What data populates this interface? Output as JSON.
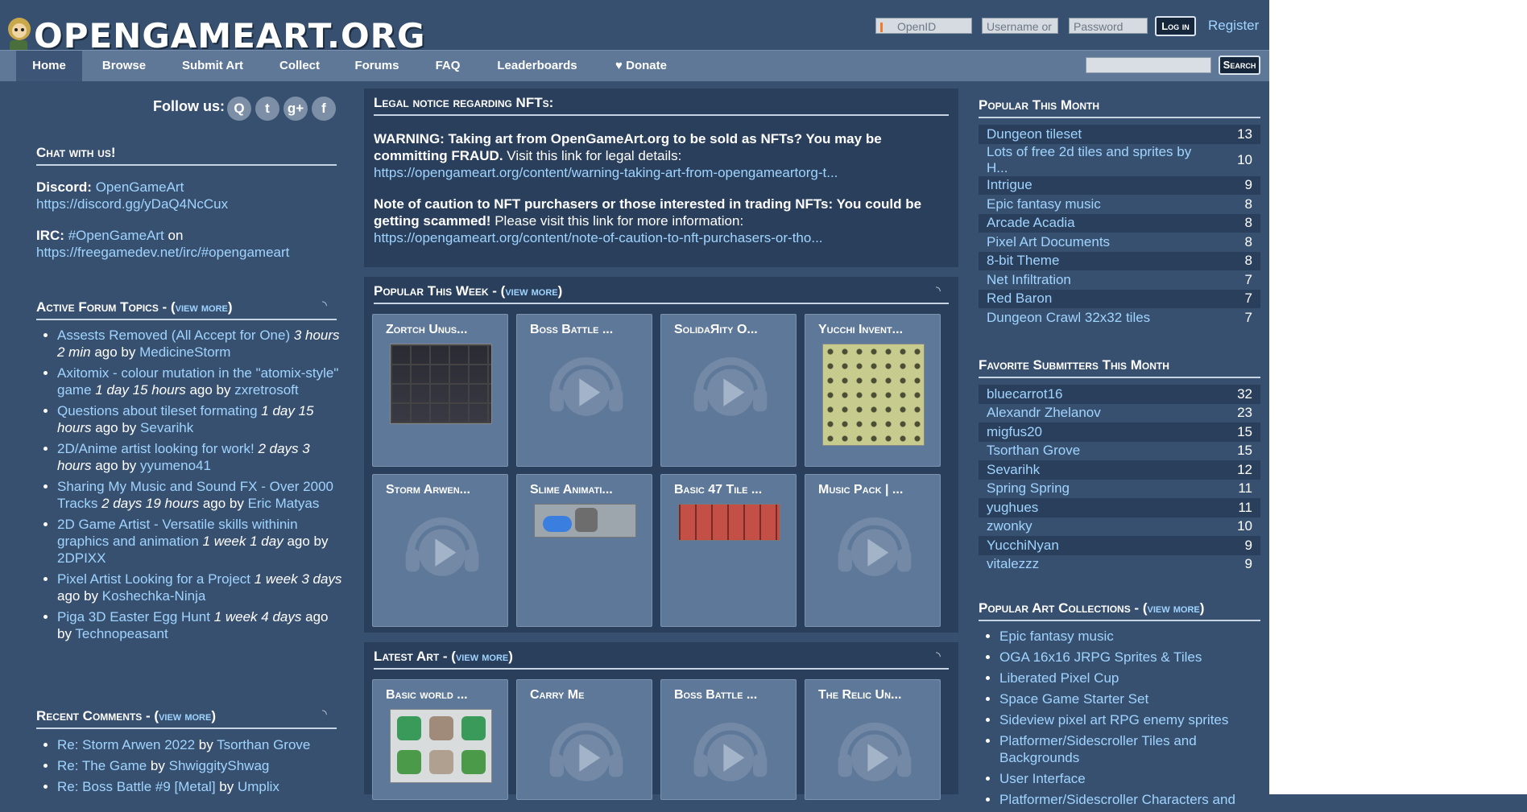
{
  "header": {
    "site_name": "OpenGameArt.Org",
    "openid_placeholder": "OpenID",
    "username_placeholder": "Username or",
    "password_placeholder": "Password",
    "login_label": "Log in",
    "register_label": "Register",
    "search_label": "Search"
  },
  "nav": {
    "items": [
      "Home",
      "Browse",
      "Submit Art",
      "Collect",
      "Forums",
      "FAQ",
      "Leaderboards",
      "Donate"
    ],
    "heart_glyph": "♥"
  },
  "follow": {
    "label": "Follow us:",
    "icons": [
      "Q",
      "t",
      "g+",
      "f"
    ]
  },
  "chat": {
    "title": "Chat with us!",
    "discord_label": "Discord:",
    "discord_name": "OpenGameArt",
    "discord_url": "https://discord.gg/yDaQ4NcCux",
    "irc_label": "IRC:",
    "irc_channel": "#OpenGameArt",
    "irc_on": "on",
    "irc_url": "https://freegamedev.net/irc/#opengameart"
  },
  "forum": {
    "title": "Active Forum Topics -",
    "view_more": "view more",
    "topics": [
      {
        "title": "Assests Removed (All Accept for One)",
        "time": "3 hours 2 min",
        "ago": "ago by",
        "user": "MedicineStorm"
      },
      {
        "title": "Axitomix - colour mutation in the \"atomix-style\" game",
        "time": "1 day 15 hours",
        "ago": "ago by",
        "user": "zxretrosoft"
      },
      {
        "title": "Questions about tileset formating",
        "time": "1 day 15 hours",
        "ago": "ago by",
        "user": "Sevarihk"
      },
      {
        "title": "2D/Anime artist looking for work!",
        "time": "2 days 3 hours",
        "ago": "ago by",
        "user": "yyumeno41"
      },
      {
        "title": "Sharing My Music and Sound FX - Over 2000 Tracks",
        "time": "2 days 19 hours",
        "ago": "ago by",
        "user": "Eric Matyas"
      },
      {
        "title": "2D Game Artist - Versatile skills withinin graphics and animation",
        "time": "1 week 1 day",
        "ago": "ago by",
        "user": "2DPIXX"
      },
      {
        "title": "Pixel Artist Looking for a Project",
        "time": "1 week 3 days",
        "ago": "ago by",
        "user": "Koshechka-Ninja"
      },
      {
        "title": "Piga 3D Easter Egg Hunt",
        "time": "1 week 4 days",
        "ago": "ago by",
        "user": "Technopeasant"
      }
    ]
  },
  "comments": {
    "title": "Recent Comments -",
    "view_more": "view more",
    "items": [
      {
        "title": "Re: Storm Arwen 2022",
        "by": "by",
        "user": "Tsorthan Grove"
      },
      {
        "title": "Re: The Game",
        "by": "by",
        "user": "ShwiggityShwag"
      },
      {
        "title": "Re: Boss Battle #9 [Metal]",
        "by": "by",
        "user": "Umplix"
      }
    ]
  },
  "legal": {
    "title": "Legal notice regarding NFTs:",
    "p1_bold": "WARNING: Taking art from OpenGameArt.org to be sold as NFTs? You may be committing FRAUD.",
    "p1_text": "Visit this link for legal details:",
    "p1_link": "https://opengameart.org/content/warning-taking-art-from-opengameartorg-t...",
    "p2_bold": "Note of caution to NFT purchasers or those interested in trading NFTs: You could be getting scammed!",
    "p2_text": "Please visit this link for more information:",
    "p2_link": "https://opengameart.org/content/note-of-caution-to-nft-purchasers-or-tho..."
  },
  "popular_week": {
    "title": "Popular This Week -",
    "view_more": "view more",
    "cards": [
      {
        "title": "Zortch Unus...",
        "kind": "tiles"
      },
      {
        "title": "Boss Battle ...",
        "kind": "audio"
      },
      {
        "title": "SolidaЯity O...",
        "kind": "audio"
      },
      {
        "title": "Yucchi Invent...",
        "kind": "items"
      },
      {
        "title": "Storm Arwen...",
        "kind": "audio"
      },
      {
        "title": "Slime Animati...",
        "kind": "slime"
      },
      {
        "title": "Basic 47 Tile ...",
        "kind": "red"
      },
      {
        "title": "Music Pack | ...",
        "kind": "audio"
      }
    ]
  },
  "latest_art": {
    "title": "Latest Art -",
    "view_more": "view more",
    "cards": [
      {
        "title": "Basic world ...",
        "kind": "world"
      },
      {
        "title": "Carry Me",
        "kind": "audio"
      },
      {
        "title": "Boss Battle ...",
        "kind": "audio"
      },
      {
        "title": "The Relic Un...",
        "kind": "audio"
      }
    ]
  },
  "popular_month": {
    "title": "Popular This Month",
    "items": [
      {
        "name": "Dungeon tileset",
        "count": "13"
      },
      {
        "name": "Lots of free 2d tiles and sprites by H...",
        "count": "10"
      },
      {
        "name": "Intrigue",
        "count": "9"
      },
      {
        "name": "Epic fantasy music",
        "count": "8"
      },
      {
        "name": "Arcade Acadia",
        "count": "8"
      },
      {
        "name": "Pixel Art Documents",
        "count": "8"
      },
      {
        "name": "8-bit Theme",
        "count": "8"
      },
      {
        "name": "Net Infiltration",
        "count": "7"
      },
      {
        "name": "Red Baron",
        "count": "7"
      },
      {
        "name": "Dungeon Crawl 32x32 tiles",
        "count": "7"
      }
    ]
  },
  "fav_submitters": {
    "title": "Favorite Submitters This Month",
    "items": [
      {
        "name": "bluecarrot16",
        "count": "32"
      },
      {
        "name": "Alexandr Zhelanov",
        "count": "23"
      },
      {
        "name": "migfus20",
        "count": "15"
      },
      {
        "name": "Tsorthan Grove",
        "count": "15"
      },
      {
        "name": "Sevarihk",
        "count": "12"
      },
      {
        "name": "Spring Spring",
        "count": "11"
      },
      {
        "name": "yughues",
        "count": "11"
      },
      {
        "name": "zwonky",
        "count": "10"
      },
      {
        "name": "YucchiNyan",
        "count": "9"
      },
      {
        "name": "vitalezzz",
        "count": "9"
      }
    ]
  },
  "collections": {
    "title": "Popular Art Collections -",
    "view_more": "view more",
    "items": [
      "Epic fantasy music",
      "OGA 16x16 JRPG Sprites & Tiles",
      "Liberated Pixel Cup",
      "Space Game Starter Set",
      "Sideview pixel art RPG enemy sprites",
      "Platformer/Sidescroller Tiles and Backgrounds",
      "User Interface",
      "Platformer/Sidescroller Characters and"
    ]
  },
  "colors": {
    "bg": "#38506f",
    "panel": "#2a3f5c",
    "link": "#9fd4ff",
    "nav": "#5f7898"
  }
}
